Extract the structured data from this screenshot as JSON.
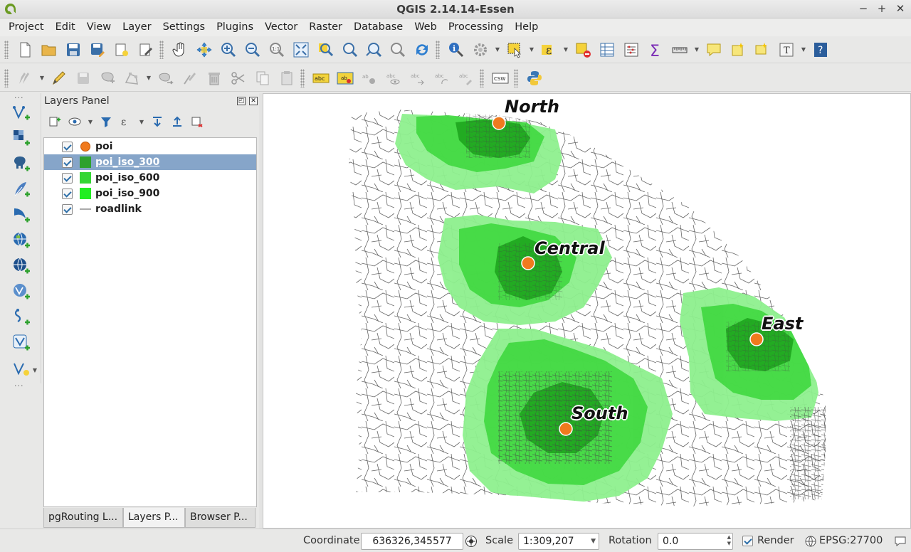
{
  "window": {
    "title": "QGIS 2.14.14-Essen",
    "minimize": "−",
    "maximize": "+",
    "close": "✕"
  },
  "menu": [
    "Project",
    "Edit",
    "View",
    "Layer",
    "Settings",
    "Plugins",
    "Vector",
    "Raster",
    "Database",
    "Web",
    "Processing",
    "Help"
  ],
  "toolbar2": {
    "csw_label": "CSW",
    "label_tool_text": "abc"
  },
  "layers_panel": {
    "title": "Layers Panel",
    "layers": [
      {
        "name": "poi",
        "symbol": "point",
        "color": "#f07a1e",
        "checked": true,
        "selected": false
      },
      {
        "name": "poi_iso_300",
        "symbol": "fill",
        "color": "#2ea12e",
        "checked": true,
        "selected": true
      },
      {
        "name": "poi_iso_600",
        "symbol": "fill",
        "color": "#34d634",
        "checked": true,
        "selected": false
      },
      {
        "name": "poi_iso_900",
        "symbol": "fill",
        "color": "#22ee22",
        "checked": true,
        "selected": false
      },
      {
        "name": "roadlink",
        "symbol": "line",
        "color": "#555555",
        "checked": true,
        "selected": false
      }
    ],
    "tabs": [
      "pgRouting L...",
      "Layers P...",
      "Browser P..."
    ],
    "active_tab": "Layers P..."
  },
  "map": {
    "poi_labels": [
      "North",
      "Central",
      "East",
      "South"
    ],
    "colors": {
      "iso_900": "#8ef08e",
      "iso_600": "#3fd83f",
      "iso_300": "#1ea51e",
      "poi": "#f07a1e",
      "roads": "#5a5a5a"
    }
  },
  "statusbar": {
    "coordinate_label": "Coordinate",
    "coordinate_value": "636326,345577",
    "scale_label": "Scale",
    "scale_value": "1:309,207",
    "rotation_label": "Rotation",
    "rotation_value": "0.0",
    "render_label": "Render",
    "render_checked": true,
    "crs": "EPSG:27700"
  }
}
